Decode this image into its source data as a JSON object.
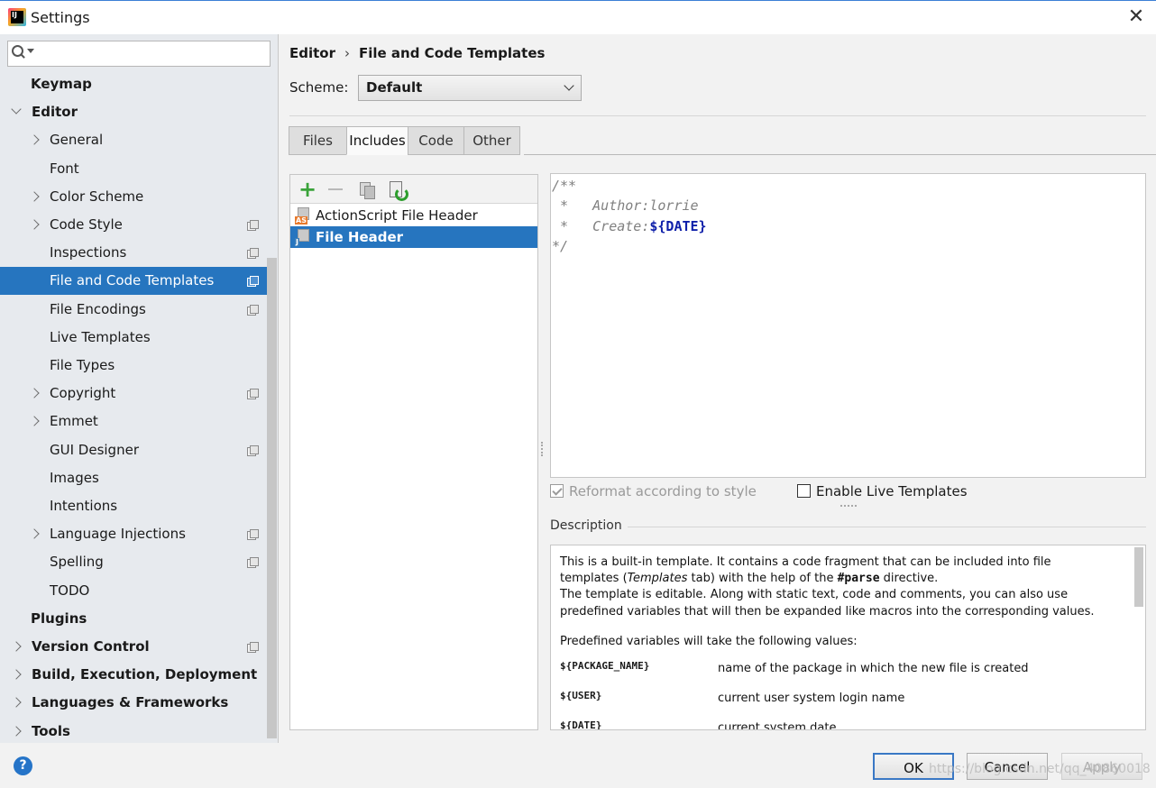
{
  "window": {
    "title": "Settings"
  },
  "search": {
    "value": "",
    "placeholder": ""
  },
  "sidebar": {
    "items": [
      {
        "label": "Keymap",
        "level": 0,
        "bold": true,
        "expander": "none",
        "project_icon": false
      },
      {
        "label": "Editor",
        "level": 0,
        "bold": true,
        "expander": "expanded",
        "project_icon": false
      },
      {
        "label": "General",
        "level": 1,
        "bold": false,
        "expander": "collapsed",
        "project_icon": false
      },
      {
        "label": "Font",
        "level": 1,
        "bold": false,
        "expander": "none",
        "project_icon": false
      },
      {
        "label": "Color Scheme",
        "level": 1,
        "bold": false,
        "expander": "collapsed",
        "project_icon": false
      },
      {
        "label": "Code Style",
        "level": 1,
        "bold": false,
        "expander": "collapsed",
        "project_icon": true
      },
      {
        "label": "Inspections",
        "level": 1,
        "bold": false,
        "expander": "none",
        "project_icon": true
      },
      {
        "label": "File and Code Templates",
        "level": 1,
        "bold": false,
        "expander": "none",
        "project_icon": true,
        "selected": true
      },
      {
        "label": "File Encodings",
        "level": 1,
        "bold": false,
        "expander": "none",
        "project_icon": true
      },
      {
        "label": "Live Templates",
        "level": 1,
        "bold": false,
        "expander": "none",
        "project_icon": false
      },
      {
        "label": "File Types",
        "level": 1,
        "bold": false,
        "expander": "none",
        "project_icon": false
      },
      {
        "label": "Copyright",
        "level": 1,
        "bold": false,
        "expander": "collapsed",
        "project_icon": true
      },
      {
        "label": "Emmet",
        "level": 1,
        "bold": false,
        "expander": "collapsed",
        "project_icon": false
      },
      {
        "label": "GUI Designer",
        "level": 1,
        "bold": false,
        "expander": "none",
        "project_icon": true
      },
      {
        "label": "Images",
        "level": 1,
        "bold": false,
        "expander": "none",
        "project_icon": false
      },
      {
        "label": "Intentions",
        "level": 1,
        "bold": false,
        "expander": "none",
        "project_icon": false
      },
      {
        "label": "Language Injections",
        "level": 1,
        "bold": false,
        "expander": "collapsed",
        "project_icon": true
      },
      {
        "label": "Spelling",
        "level": 1,
        "bold": false,
        "expander": "none",
        "project_icon": true
      },
      {
        "label": "TODO",
        "level": 1,
        "bold": false,
        "expander": "none",
        "project_icon": false
      },
      {
        "label": "Plugins",
        "level": 0,
        "bold": true,
        "expander": "none",
        "project_icon": false
      },
      {
        "label": "Version Control",
        "level": 0,
        "bold": true,
        "expander": "collapsed",
        "project_icon": true
      },
      {
        "label": "Build, Execution, Deployment",
        "level": 0,
        "bold": true,
        "expander": "collapsed",
        "project_icon": false
      },
      {
        "label": "Languages & Frameworks",
        "level": 0,
        "bold": true,
        "expander": "collapsed",
        "project_icon": false
      },
      {
        "label": "Tools",
        "level": 0,
        "bold": true,
        "expander": "collapsed",
        "project_icon": false
      }
    ]
  },
  "breadcrumb": {
    "parent": "Editor",
    "separator": "›",
    "current": "File and Code Templates"
  },
  "scheme": {
    "label": "Scheme:",
    "value": "Default"
  },
  "tabs": [
    {
      "label": "Files",
      "active": false
    },
    {
      "label": "Includes",
      "active": true
    },
    {
      "label": "Code",
      "active": false
    },
    {
      "label": "Other",
      "active": false
    }
  ],
  "templates": {
    "items": [
      {
        "label": "ActionScript File Header",
        "badge": "AS",
        "selected": false
      },
      {
        "label": "File Header",
        "badge": "J",
        "selected": true
      }
    ]
  },
  "editor": {
    "line1": "/**",
    "line2": " *   Author:lorrie",
    "line3_prefix": " *   Create:",
    "line3_macro": "${DATE}",
    "line4": "*/"
  },
  "options": {
    "reformat": {
      "label": "Reformat according to style",
      "checked": true,
      "enabled": false
    },
    "live_templates": {
      "label": "Enable Live Templates",
      "checked": false
    }
  },
  "description": {
    "label": "Description",
    "p1_line1": "This is a built-in template. It contains a code fragment that can be included into file",
    "p1_line2_a": "templates (",
    "p1_line2_b": "Templates",
    "p1_line2_c": " tab) with the help of the ",
    "p1_line2_d": "#parse",
    "p1_line2_e": " directive.",
    "p1_line3": "The template is editable. Along with static text, code and comments, you can also use",
    "p1_line4": "predefined variables that will then be expanded like macros into the corresponding values.",
    "p2": "Predefined variables will take the following values:",
    "vars": [
      {
        "name": "${PACKAGE_NAME}",
        "desc": "name of the package in which the new file is created"
      },
      {
        "name": "${USER}",
        "desc": "current user system login name"
      },
      {
        "name": "${DATE}",
        "desc": "current system date"
      }
    ]
  },
  "footer": {
    "help": "?",
    "ok": "OK",
    "cancel": "Cancel",
    "apply": "Apply",
    "watermark": "https://blog.csdn.net/qq_40860018"
  },
  "colors": {
    "selection": "#2675bf",
    "accent": "#3a78c5",
    "macro": "#0e1fa9"
  }
}
